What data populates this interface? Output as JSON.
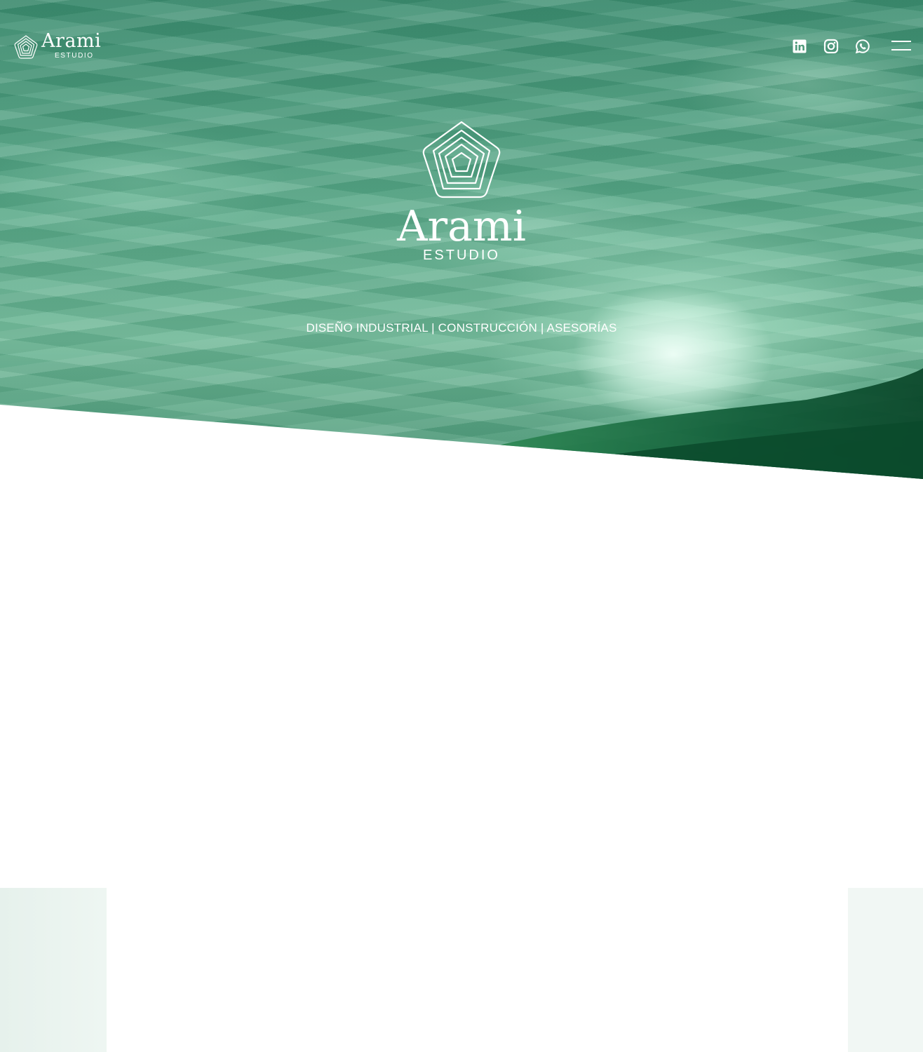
{
  "header": {
    "logo_word": "Arami",
    "logo_sub": "ESTUDIO",
    "social_icons": [
      "linkedin-icon",
      "instagram-icon",
      "whatsapp-icon"
    ],
    "menu_icon": "hamburger-menu-icon"
  },
  "hero": {
    "logo_word": "Arami",
    "logo_sub": "ESTUDIO",
    "tagline": "DISEÑO INDUSTRIAL | CONSTRUCCIÓN | ASESORÍAS"
  },
  "colors": {
    "hero_green": "#4f9a7a",
    "hill_dark": "#0b4a30",
    "panel_light": "#eaf4ef"
  }
}
